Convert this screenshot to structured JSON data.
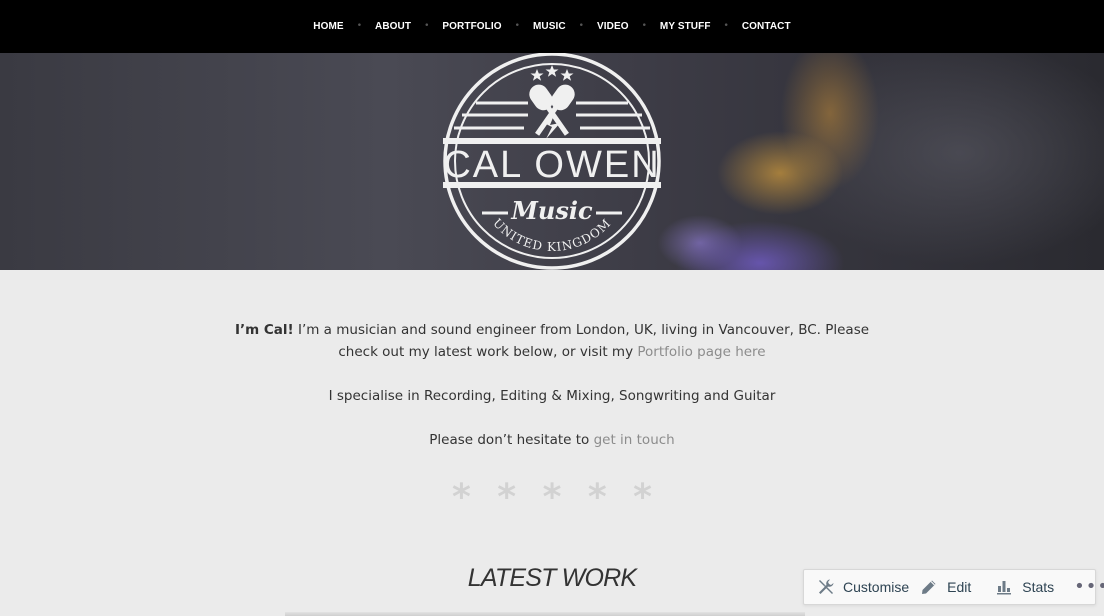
{
  "nav": {
    "items": [
      "HOME",
      "ABOUT",
      "PORTFOLIO",
      "MUSIC",
      "VIDEO",
      "MY STUFF",
      "CONTACT"
    ],
    "separator": "•"
  },
  "logo": {
    "name": "CAL OWEN",
    "script": "Music",
    "location": "UNITED KINGDOM"
  },
  "intro": {
    "bold": "I’m Cal!",
    "text": " I’m a musician and sound engineer from London, UK, living in Vancouver, BC. Please check out my latest work below, or visit my ",
    "link": "Portfolio page here"
  },
  "specialise": "I specialise in Recording, Editing & Mixing, Songwriting and Guitar",
  "contact_line": {
    "text": "Please don’t hesitate to ",
    "link": "get in touch"
  },
  "divider_stars": [
    "*",
    "*",
    "*",
    "*",
    "*"
  ],
  "section_heading": "LATEST WORK",
  "action_bar": {
    "customise": "Customise",
    "edit": "Edit",
    "stats": "Stats",
    "more": "•••"
  }
}
